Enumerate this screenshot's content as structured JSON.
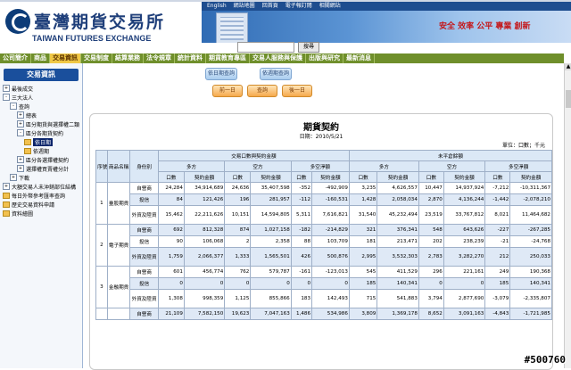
{
  "header": {
    "logo_cn": "臺灣期貨交易所",
    "logo_en": "TAIWAN FUTURES EXCHANGE",
    "top_links": [
      "English",
      "網站地圖",
      "回首頁",
      "電子報訂閱",
      "相關網站"
    ],
    "slogan": "安全 效率 公平 專業 創新",
    "search_placeholder": "",
    "search_button": "搜尋"
  },
  "nav": {
    "items": [
      "公司簡介",
      "商品",
      "交易資訊",
      "交易制度",
      "結算業務",
      "法令規章",
      "統計資料",
      "期貨教育專區",
      "交易人服務與保護",
      "出版與研究",
      "最新消息"
    ],
    "active": "交易資訊"
  },
  "sidebar": {
    "title": "交易資訊",
    "items": [
      {
        "label": "最後成交",
        "depth": 0,
        "toggle": "+"
      },
      {
        "label": "三大法人",
        "depth": 0,
        "toggle": "-"
      },
      {
        "label": "查詢",
        "depth": 1,
        "toggle": "-"
      },
      {
        "label": "總表",
        "depth": 2,
        "toggle": "+"
      },
      {
        "label": "區分期貨與選擇權二類",
        "depth": 2,
        "toggle": "+"
      },
      {
        "label": "區分各期貨契約",
        "depth": 2,
        "toggle": "-"
      },
      {
        "label": "依日期",
        "depth": 3,
        "toggle": "",
        "selected": true
      },
      {
        "label": "依週期",
        "depth": 3,
        "toggle": ""
      },
      {
        "label": "區分各選擇權契約",
        "depth": 2,
        "toggle": "+"
      },
      {
        "label": "選擇權買賣權分計",
        "depth": 2,
        "toggle": "+"
      },
      {
        "label": "下載",
        "depth": 1,
        "toggle": "+"
      },
      {
        "label": "大額交易人未沖銷部位結構",
        "depth": 0,
        "toggle": "+"
      },
      {
        "label": "每日外幣參考匯率查詢",
        "depth": 0,
        "toggle": ""
      },
      {
        "label": "歷史交易資料申請",
        "depth": 0,
        "toggle": ""
      },
      {
        "label": "資料繪圖",
        "depth": 0,
        "toggle": ""
      }
    ]
  },
  "controls": {
    "tab_date": "依日期查詢",
    "tab_period": "依週期查詢",
    "btn_prev": "前一日",
    "btn_query": "查詢",
    "btn_next": "後一日"
  },
  "report": {
    "title": "期貨契約",
    "date": "日期：2010/5/21",
    "unit": "單位：口數；千元",
    "group_headers": [
      "交易口數與契約金額",
      "未平倉餘額"
    ],
    "side_headers": [
      "多方",
      "空方",
      "多空淨額",
      "多方",
      "空方",
      "多空淨額"
    ],
    "col_headers": [
      "序號",
      "商品名稱",
      "身份別",
      "口數",
      "契約金額",
      "口數",
      "契約金額",
      "口數",
      "契約金額",
      "口數",
      "契約金額",
      "口數",
      "契約金額",
      "口數",
      "契約金額"
    ],
    "rows": [
      {
        "no": "1",
        "product": "臺股期貨",
        "role": "自營商",
        "vals": [
          "24,284",
          "34,914,689",
          "24,636",
          "35,407,598",
          "-352",
          "-492,909",
          "3,235",
          "4,626,557",
          "10,447",
          "14,937,924",
          "-7,212",
          "-10,311,367"
        ]
      },
      {
        "no": "",
        "product": "",
        "role": "投信",
        "vals": [
          "84",
          "121,426",
          "196",
          "281,957",
          "-112",
          "-160,531",
          "1,428",
          "2,058,034",
          "2,870",
          "4,136,244",
          "-1,442",
          "-2,078,210"
        ]
      },
      {
        "no": "",
        "product": "",
        "role": "外資及陸資",
        "vals": [
          "15,462",
          "22,211,626",
          "10,151",
          "14,594,805",
          "5,311",
          "7,616,821",
          "31,540",
          "45,232,494",
          "23,519",
          "33,767,812",
          "8,021",
          "11,464,682"
        ]
      },
      {
        "no": "2",
        "product": "電子期貨",
        "role": "自營商",
        "vals": [
          "692",
          "812,328",
          "874",
          "1,027,158",
          "-182",
          "-214,829",
          "321",
          "376,341",
          "548",
          "643,626",
          "-227",
          "-267,285"
        ]
      },
      {
        "no": "",
        "product": "",
        "role": "投信",
        "vals": [
          "90",
          "106,068",
          "2",
          "2,358",
          "88",
          "103,709",
          "181",
          "213,471",
          "202",
          "238,239",
          "-21",
          "-24,768"
        ]
      },
      {
        "no": "",
        "product": "",
        "role": "外資及陸資",
        "vals": [
          "1,759",
          "2,066,377",
          "1,333",
          "1,565,501",
          "426",
          "500,876",
          "2,995",
          "3,532,303",
          "2,783",
          "3,282,270",
          "212",
          "250,033"
        ]
      },
      {
        "no": "3",
        "product": "金融期貨",
        "role": "自營商",
        "vals": [
          "601",
          "456,774",
          "762",
          "579,787",
          "-161",
          "-123,013",
          "545",
          "411,529",
          "296",
          "221,161",
          "249",
          "190,368"
        ]
      },
      {
        "no": "",
        "product": "",
        "role": "投信",
        "vals": [
          "0",
          "0",
          "0",
          "0",
          "0",
          "0",
          "185",
          "140,341",
          "0",
          "0",
          "185",
          "140,341"
        ]
      },
      {
        "no": "",
        "product": "",
        "role": "外資及陸資",
        "vals": [
          "1,308",
          "998,359",
          "1,125",
          "855,866",
          "183",
          "142,493",
          "715",
          "541,883",
          "3,794",
          "2,877,690",
          "-3,079",
          "-2,335,807"
        ]
      },
      {
        "no": "",
        "product": "",
        "role": "自營商",
        "vals": [
          "21,109",
          "7,582,150",
          "19,623",
          "7,047,163",
          "1,486",
          "534,986",
          "3,809",
          "1,369,178",
          "8,652",
          "3,091,163",
          "-4,843",
          "-1,721,985"
        ]
      }
    ]
  },
  "watermark": "#500760"
}
